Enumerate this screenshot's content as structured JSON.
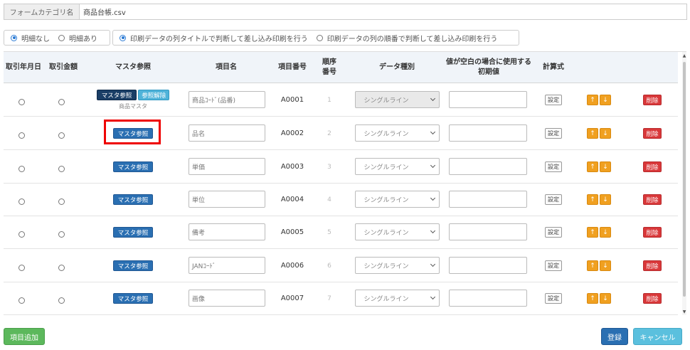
{
  "form": {
    "category_label": "フォームカテゴリ名",
    "category_value": "商品台帳.csv"
  },
  "options": {
    "detail": [
      {
        "label": "明細なし",
        "selected": true
      },
      {
        "label": "明細あり",
        "selected": false
      }
    ],
    "print_mode": [
      {
        "label": "印刷データの列タイトルで判断して差し込み印刷を行う",
        "selected": true
      },
      {
        "label": "印刷データの列の順番で判断して差し込み印刷を行う",
        "selected": false
      }
    ]
  },
  "headers": {
    "date": "取引年月日",
    "amount": "取引金額",
    "master": "マスタ参照",
    "item_name": "項目名",
    "item_no": "項目番号",
    "order": "順序番号",
    "data_type": "データ種別",
    "default": "値が空白の場合に使用する初期値",
    "formula": "計算式"
  },
  "buttons": {
    "master_ref": "マスタ参照",
    "master_cancel": "参照解除",
    "master_sub": "商品マスタ",
    "calc": "設定",
    "up": "↑",
    "down": "↓",
    "delete": "削除",
    "add_item": "項目追加",
    "register": "登録",
    "cancel": "キャンセル"
  },
  "rows": [
    {
      "item_name": "商品ｺｰﾄﾞ(品番)",
      "item_no": "A0001",
      "order": "1",
      "data_type": "シングルライン",
      "default": "",
      "master_linked": true
    },
    {
      "item_name": "品名",
      "item_no": "A0002",
      "order": "2",
      "data_type": "シングルライン",
      "default": "",
      "master_linked": false
    },
    {
      "item_name": "単価",
      "item_no": "A0003",
      "order": "3",
      "data_type": "シングルライン",
      "default": "",
      "master_linked": false
    },
    {
      "item_name": "単位",
      "item_no": "A0004",
      "order": "4",
      "data_type": "シングルライン",
      "default": "",
      "master_linked": false
    },
    {
      "item_name": "備考",
      "item_no": "A0005",
      "order": "5",
      "data_type": "シングルライン",
      "default": "",
      "master_linked": false
    },
    {
      "item_name": "JANｺｰﾄﾞ",
      "item_no": "A0006",
      "order": "6",
      "data_type": "シングルライン",
      "default": "",
      "master_linked": false
    },
    {
      "item_name": "画像",
      "item_no": "A0007",
      "order": "7",
      "data_type": "シングルライン",
      "default": "",
      "master_linked": false
    }
  ],
  "colors": {
    "primary": "#2a6fb2",
    "danger": "#d9383a",
    "warning": "#f0a020",
    "success": "#5cb85c",
    "info": "#5bc0de",
    "highlight": "#e00000"
  }
}
